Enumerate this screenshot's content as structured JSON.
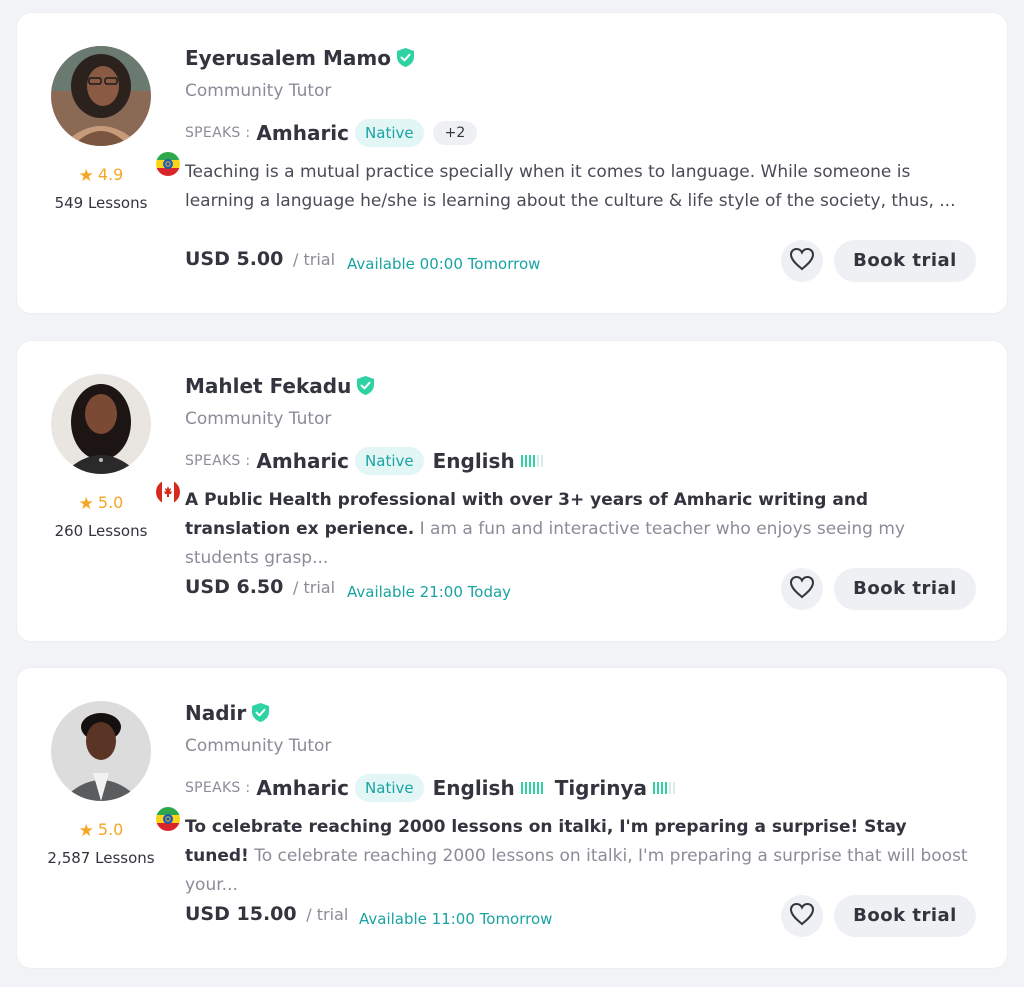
{
  "tutors": [
    {
      "name": "Eyerusalem Mamo",
      "role": "Community Tutor",
      "speaks_label": "SPEAKS :",
      "native_language": "Amharic",
      "native_tag": "Native",
      "more_languages": "+2",
      "rating": "4.9",
      "lessons": "549 Lessons",
      "description": "Teaching is a mutual practice specially when it comes to language. While someone is learning a language he/she is learning about the culture & life style of the society, thus, ...",
      "price": "USD 5.00",
      "price_unit": "/ trial",
      "availability": "Available 00:00 Tomorrow",
      "book_label": "Book trial",
      "flag": "ethiopia-flag-icon"
    },
    {
      "name": "Mahlet Fekadu",
      "role": "Community Tutor",
      "speaks_label": "SPEAKS :",
      "native_language": "Amharic",
      "native_tag": "Native",
      "other_language": "English",
      "other_level": 4,
      "rating": "5.0",
      "lessons": "260 Lessons",
      "description_bold": "A Public Health professional with over 3+ years of Amharic writing and translation ex perience.",
      "description_rest": "I am a fun and interactive teacher who enjoys seeing my students grasp...",
      "price": "USD 6.50",
      "price_unit": "/ trial",
      "availability": "Available 21:00 Today",
      "book_label": "Book trial",
      "flag": "canada-flag-icon"
    },
    {
      "name": "Nadir",
      "role": "Community Tutor",
      "speaks_label": "SPEAKS :",
      "native_language": "Amharic",
      "native_tag": "Native",
      "other_language": "English",
      "other_level": 6,
      "third_language": "Tigrinya",
      "third_level": 4,
      "rating": "5.0",
      "lessons": "2,587 Lessons",
      "description_bold": "To celebrate reaching 2000 lessons on italki, I'm preparing a surprise! Stay tuned!",
      "description_rest": "To celebrate reaching 2000 lessons on italki, I'm preparing a surprise that will boost your...",
      "price": "USD 15.00",
      "price_unit": "/ trial",
      "availability": "Available 11:00 Tomorrow",
      "book_label": "Book trial",
      "flag": "ethiopia-flag-icon"
    }
  ],
  "colors": {
    "accent_teal": "#1aa3a3",
    "level_green": "#2fd3a3",
    "star": "#f5a623",
    "verified": "#2fd3a3"
  }
}
